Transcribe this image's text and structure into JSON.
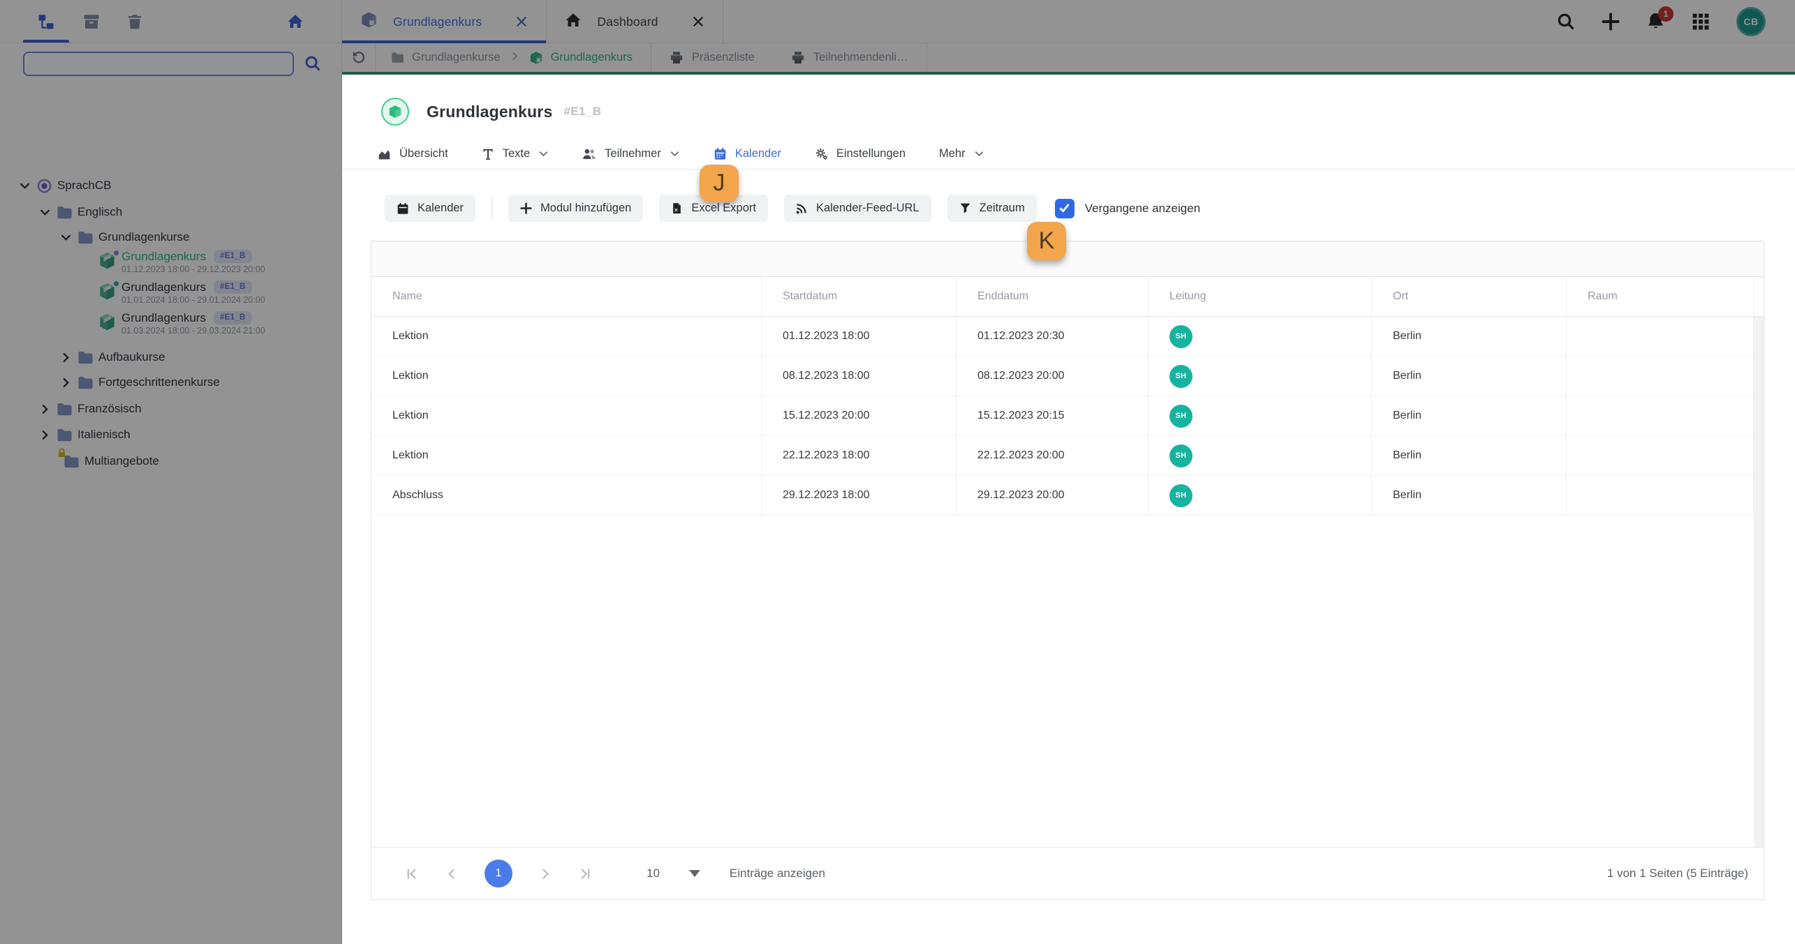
{
  "sidebar": {
    "search_value": "",
    "items": {
      "sprachcb": "SprachCB",
      "englisch": "Englisch",
      "grundlagenkurse": "Grundlagenkurse",
      "aufbaukurse": "Aufbaukurse",
      "fortgeschrittenenkurse": "Fortgeschrittenenkurse",
      "franzoesisch": "Französisch",
      "italienisch": "Italienisch",
      "multiangebote": "Multiangebote"
    },
    "courses": [
      {
        "title": "Grundlagenkurs",
        "badge": "#E1_B",
        "dates": "01.12.2023 18:00 - 29.12.2023 20:00",
        "selected": true
      },
      {
        "title": "Grundlagenkurs",
        "badge": "#E1_B",
        "dates": "01.01.2024 18:00 - 29.01.2024 20:00",
        "selected": false
      },
      {
        "title": "Grundlagenkurs",
        "badge": "#E1_B",
        "dates": "01.03.2024 18:00 - 29.03.2024 21:00",
        "selected": false
      }
    ]
  },
  "topbar": {
    "tabs": [
      {
        "label": "Grundlagenkurs",
        "active": true
      },
      {
        "label": "Dashboard",
        "active": false
      }
    ],
    "notification_count": "1",
    "avatar_initials": "CB"
  },
  "breadcrumb": {
    "folder": "Grundlagenkurse",
    "current": "Grundlagenkurs",
    "print_tabs": [
      {
        "label": "Präsenzliste"
      },
      {
        "label": "Teilnehmendenli…"
      }
    ]
  },
  "page": {
    "title": "Grundlagenkurs",
    "code": "#E1_B",
    "tabs": [
      {
        "label": "Übersicht"
      },
      {
        "label": "Texte"
      },
      {
        "label": "Teilnehmer"
      },
      {
        "label": "Kalender"
      },
      {
        "label": "Einstellungen"
      },
      {
        "label": "Mehr"
      }
    ],
    "active_tab": "Kalender",
    "toolbar": {
      "kalender": "Kalender",
      "modul": "Modul hinzufügen",
      "excel": "Excel Export",
      "feed": "Kalender-Feed-URL",
      "zeitraum": "Zeitraum",
      "checkbox_label": "Vergangene anzeigen",
      "checkbox_checked": true
    }
  },
  "table": {
    "columns": [
      "Name",
      "Startdatum",
      "Enddatum",
      "Leitung",
      "Ort",
      "Raum"
    ],
    "rows": [
      {
        "name": "Lektion",
        "start": "01.12.2023 18:00",
        "end": "01.12.2023 20:30",
        "leitung": "SH",
        "ort": "Berlin",
        "raum": ""
      },
      {
        "name": "Lektion",
        "start": "08.12.2023 18:00",
        "end": "08.12.2023 20:00",
        "leitung": "SH",
        "ort": "Berlin",
        "raum": ""
      },
      {
        "name": "Lektion",
        "start": "15.12.2023 20:00",
        "end": "15.12.2023 20:15",
        "leitung": "SH",
        "ort": "Berlin",
        "raum": ""
      },
      {
        "name": "Lektion",
        "start": "22.12.2023 18:00",
        "end": "22.12.2023 20:00",
        "leitung": "SH",
        "ort": "Berlin",
        "raum": ""
      },
      {
        "name": "Abschluss",
        "start": "29.12.2023 18:00",
        "end": "29.12.2023 20:00",
        "leitung": "SH",
        "ort": "Berlin",
        "raum": ""
      }
    ]
  },
  "pagination": {
    "page": "1",
    "page_size": "10",
    "entries_label": "Einträge anzeigen",
    "summary": "1 von 1 Seiten (5 Einträge)"
  },
  "annotations": {
    "j": "J",
    "k": "K"
  },
  "colors": {
    "accent_blue": "#3f6ce0",
    "green": "#2bb283",
    "teal_avatar": "#17b3a1",
    "annotation_orange": "#f3a54c",
    "checkbox_blue": "#2d6ae3",
    "notification_red": "#c4322e"
  }
}
